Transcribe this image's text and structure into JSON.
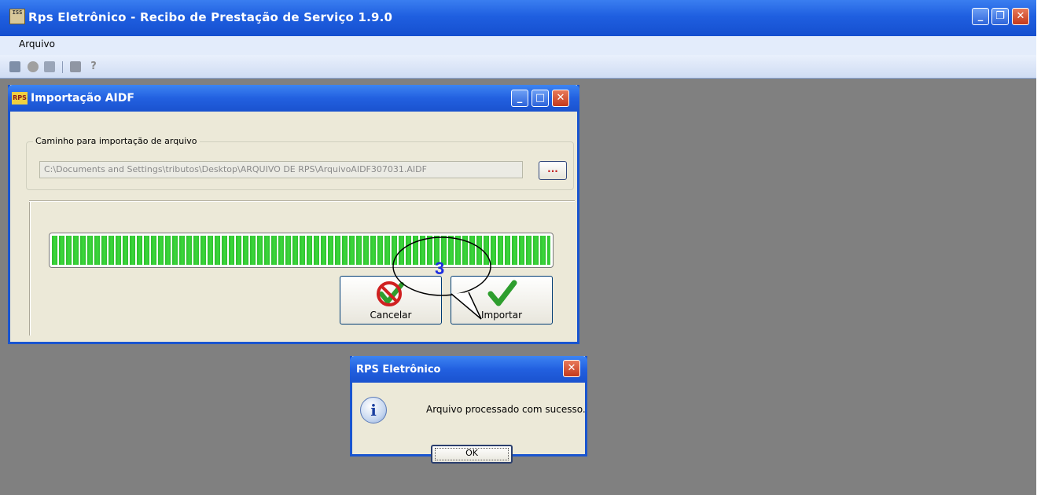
{
  "main_window": {
    "title": "Rps Eletrônico - Recibo de Prestação de Serviço 1.9.0",
    "icon_text": "ISS",
    "controls": {
      "minimize": "_",
      "maximize": "❐",
      "close": "✕"
    }
  },
  "menubar": {
    "items": [
      {
        "label": "Arquivo"
      }
    ]
  },
  "toolbar": {
    "icons": [
      "save-icon",
      "gear-icon",
      "edit-icon",
      "print-icon",
      "help-icon"
    ]
  },
  "aidf_window": {
    "title": "Importação AIDF",
    "icon_text": "RPS",
    "path_group_label": "Caminho para importação de arquivo",
    "path_value": "C:\\Documents and Settings\\tributos\\Desktop\\ARQUIVO DE RPS\\ArquivoAIDF307031.AIDF",
    "browse_label": "...",
    "progress_fraction": 1.0,
    "cancel_label": "Cancelar",
    "import_label": "Importar",
    "controls": {
      "minimize": "_",
      "maximize": "□",
      "close": "✕"
    }
  },
  "callout": {
    "label": "3"
  },
  "message_dialog": {
    "title": "RPS Eletrônico",
    "message": "Arquivo processado com sucesso.",
    "ok_label": "OK",
    "icon": "info-icon",
    "icon_glyph": "i",
    "close": "✕"
  },
  "colors": {
    "titlebar_blue": "#2260e0",
    "desktop_gray": "#808080",
    "progress_green": "#3bd83b",
    "callout_blue": "#1d2de0"
  }
}
